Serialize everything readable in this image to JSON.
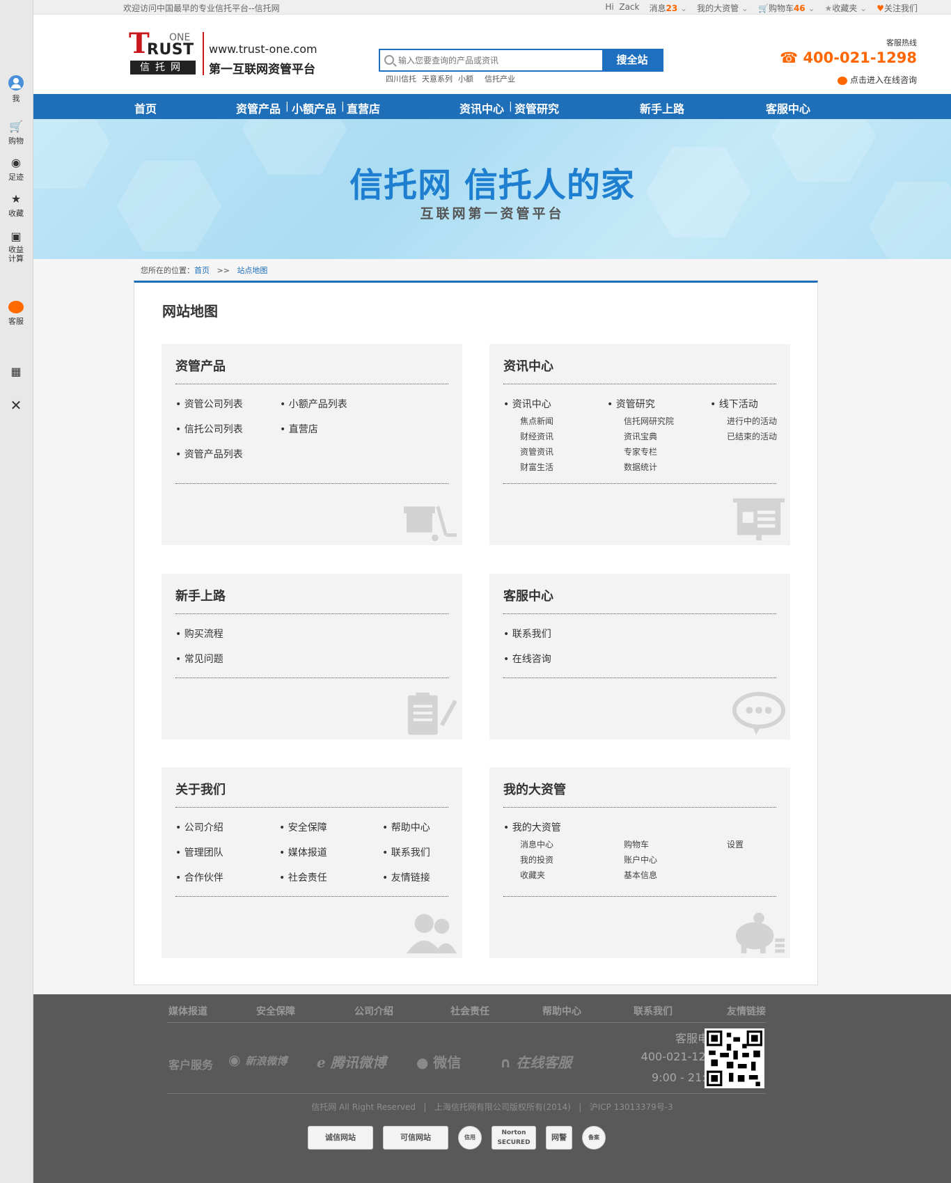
{
  "topbar": {
    "welcome": "欢迎访问中国最早的专业信托平台--信托网",
    "hi": "Hi",
    "user": "Zack",
    "messages": "消息",
    "messages_count": "23",
    "my_assets": "我的大资管",
    "cart": "购物车",
    "cart_count": "46",
    "favorites": "收藏夹",
    "follow": "关注我们"
  },
  "sidebar": {
    "me": "我",
    "shop": "购物",
    "footprint": "足迹",
    "collect": "收藏",
    "calc": "收益计算",
    "service": "客服"
  },
  "header": {
    "logo_one": "ONE",
    "logo_t": "T",
    "logo_rust": "RUST",
    "logo_cn": "信托网",
    "site_url": "www.trust-one.com",
    "slogan": "第一互联网资管平台",
    "search_placeholder": "输入您要查询的产品或资讯",
    "search_button": "搜全站",
    "hot_links": [
      "四川信托",
      "天意系列",
      "小额",
      "信托产业"
    ],
    "hotline_label": "客服热线",
    "hotline": "☎ 400-021-1298",
    "online": "点击进入在线咨询"
  },
  "nav": {
    "home": "首页",
    "products": "资管产品",
    "small": "小额产品",
    "store": "直营店",
    "news": "资讯中心",
    "research": "资管研究",
    "newbie": "新手上路",
    "service": "客服中心"
  },
  "banner": {
    "title": "信托网 信托人的家",
    "subtitle": "互联网第一资管平台"
  },
  "breadcrumb": {
    "prefix": "您所在的位置：",
    "home": "首页",
    "arrow": ">>",
    "current": "站点地图"
  },
  "main": {
    "title": "网站地图",
    "cards": {
      "products": {
        "title": "资管产品",
        "links": [
          "资管公司列表",
          "小额产品列表",
          "信托公司列表",
          "直营店",
          "资管产品列表"
        ]
      },
      "news": {
        "title": "资讯中心",
        "col1": "资讯中心",
        "col1_items": [
          "焦点新闻",
          "财经资讯",
          "资管资讯",
          "财富生活"
        ],
        "col2": "资管研究",
        "col2_items": [
          "信托网研究院",
          "资讯宝典",
          "专家专栏",
          "数据统计"
        ],
        "col3": "线下活动",
        "col3_items": [
          "进行中的活动",
          "已结束的活动"
        ]
      },
      "newbie": {
        "title": "新手上路",
        "links": [
          "购买流程",
          "常见问题"
        ]
      },
      "service": {
        "title": "客服中心",
        "links": [
          "联系我们",
          "在线咨询"
        ]
      },
      "about": {
        "title": "关于我们",
        "links": [
          "公司介绍",
          "安全保障",
          "帮助中心",
          "管理团队",
          "媒体报道",
          "联系我们",
          "合作伙伴",
          "社会责任",
          "友情链接"
        ]
      },
      "mine": {
        "title": "我的大资管",
        "head": "我的大资管",
        "items": [
          "消息中心",
          "购物车",
          "设置",
          "我的投资",
          "账户中心",
          "收藏夹",
          "基本信息"
        ]
      }
    }
  },
  "footer": {
    "nav": [
      "媒体报道",
      "安全保障",
      "公司介绍",
      "社会责任",
      "帮助中心",
      "联系我们",
      "友情链接"
    ],
    "cs_label": "客户服务",
    "social": [
      "新浪微博",
      "腾讯微博",
      "微信",
      "在线客服"
    ],
    "phone_label": "客服电话",
    "phone": "400-021-1298",
    "hours": "9:00 - 21:00",
    "copyright": [
      "信托网 All Right Reserved",
      "上海信托网有限公司版权所有(2014)",
      "沪ICP 13013379号-3"
    ],
    "badges": [
      "诚信网站",
      "可信网站",
      "信用",
      "Norton SECURED",
      "网警",
      "备案"
    ]
  }
}
